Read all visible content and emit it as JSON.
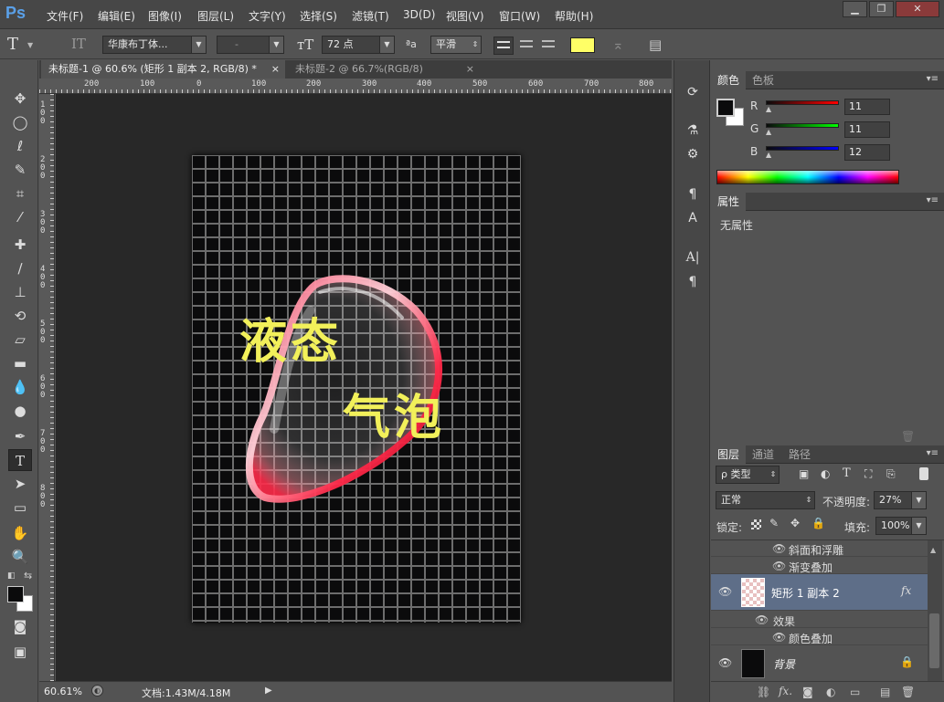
{
  "app": {
    "logo": "Ps"
  },
  "menu": [
    "文件(F)",
    "编辑(E)",
    "图像(I)",
    "图层(L)",
    "文字(Y)",
    "选择(S)",
    "滤镜(T)",
    "3D(D)",
    "视图(V)",
    "窗口(W)",
    "帮助(H)"
  ],
  "window_controls": {
    "minimize": "▁",
    "restore": "❐",
    "close": "✕"
  },
  "options": {
    "font_family": "华康布丁体...",
    "font_style": "-",
    "font_size": "72 点",
    "aa_label": "ªa",
    "anti_alias": "平滑",
    "text_color": "#ffff66"
  },
  "tabs": [
    {
      "label": "未标题-1 @ 60.6% (矩形 1 副本 2, RGB/8) *",
      "close": "×"
    },
    {
      "label": "未标题-2 @ 66.7%(RGB/8)",
      "close": "×"
    }
  ],
  "ruler_h": [
    "200",
    "100",
    "0",
    "100",
    "200",
    "300",
    "400",
    "500",
    "600",
    "700",
    "800"
  ],
  "ruler_v": [
    "100",
    "200",
    "300",
    "400",
    "500",
    "600",
    "700",
    "800"
  ],
  "canvas": {
    "text_line1": "液态",
    "text_line2": "气泡",
    "text_color": "#f2f05a",
    "grid_color": "#6d6d6d"
  },
  "status": {
    "zoom": "60.61%",
    "doc": "文档:1.43M/4.18M"
  },
  "color_panel": {
    "tabs": [
      "颜色",
      "色板"
    ],
    "r_label": "R",
    "g_label": "G",
    "b_label": "B",
    "r": "11",
    "g": "11",
    "b": "12"
  },
  "properties_panel": {
    "tab": "属性",
    "content": "无属性"
  },
  "layers_panel": {
    "tabs": [
      "图层",
      "通道",
      "路径"
    ],
    "filter": "ρ 类型",
    "blend_mode": "正常",
    "opacity_label": "不透明度:",
    "opacity": "27%",
    "lock_label": "锁定:",
    "fill_label": "填充:",
    "fill": "100%",
    "layers": [
      {
        "name": "斜面和浮雕",
        "kind": "effect"
      },
      {
        "name": "渐变叠加",
        "kind": "effect"
      },
      {
        "name": "矩形 1 副本 2",
        "kind": "layer",
        "fx": "fx"
      },
      {
        "name": "效果",
        "kind": "effects-header"
      },
      {
        "name": "颜色叠加",
        "kind": "effect"
      },
      {
        "name": "背景",
        "kind": "layer"
      }
    ],
    "footer_fx": "fx."
  }
}
